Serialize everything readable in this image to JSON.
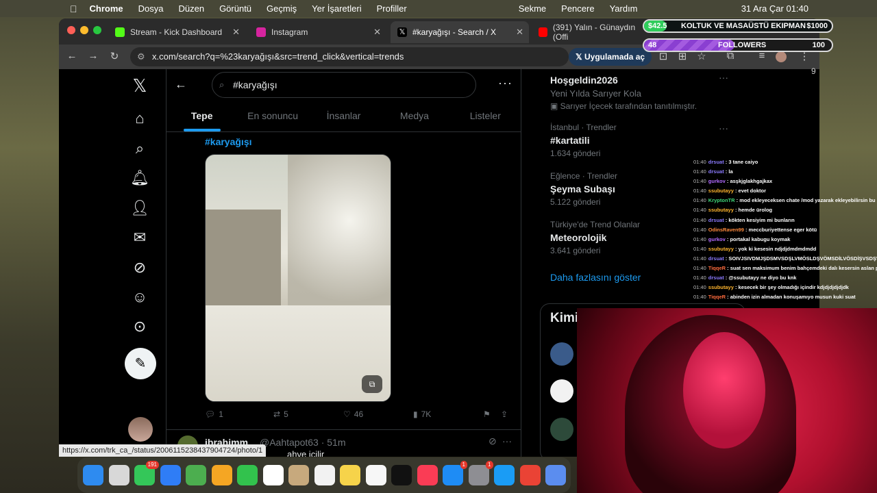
{
  "menubar": {
    "app": "Chrome",
    "items": [
      "Dosya",
      "Düzen",
      "Görüntü",
      "Geçmiş",
      "Yer İşaretleri",
      "Profiller"
    ],
    "right_items": [
      "Sekme",
      "Pencere",
      "Yardım"
    ],
    "clock": "31 Ara Çar  01:40"
  },
  "tabs": [
    {
      "title": "Stream - Kick Dashboard",
      "color": "#53fc18"
    },
    {
      "title": "Instagram",
      "color": "#d6249f"
    },
    {
      "title": "#karyağışı - Search / X",
      "color": "#ffffff"
    },
    {
      "title": "(391) Yalın - Günaydın (Offi",
      "color": "#ff0000"
    }
  ],
  "url": "x.com/search?q=%23karyağışı&src=trend_click&vertical=trends",
  "open_in_app": "Uygulamada aç",
  "search_value": "#karyağışı",
  "x_tabs": [
    "Tepe",
    "En sonuncu",
    "İnsanlar",
    "Medya",
    "Listeler"
  ],
  "tweet": {
    "hashtag": "#karyağışı",
    "replies": "1",
    "reposts": "5",
    "likes": "46",
    "views": "7K"
  },
  "next_tweet": {
    "name": "ibrahimm",
    "handle": "@Aahtapot63 · 51m",
    "snippet": "ahve içilir"
  },
  "status_url": "https://x.com/trk_ca_/status/2006115238437904724/photo/1",
  "trends": [
    {
      "context": "",
      "title": "Hoşgeldin2026",
      "subtitle": "Yeni Yılda Sarıyer Kola",
      "count": "Sarıyer İçecek tarafından tanıtılmıştır."
    },
    {
      "context": "İstanbul · Trendler",
      "title": "#kartatili",
      "subtitle": "",
      "count": "1.634 gönderi"
    },
    {
      "context": "Eğlence · Trendler",
      "title": "Şeyma Subaşı",
      "subtitle": "",
      "count": "5.122 gönderi"
    },
    {
      "context": "Türkiye'de Trend Olanlar",
      "title": "Meteorolojik",
      "subtitle": "",
      "count": "3.641 gönderi"
    }
  ],
  "show_more": "Daha fazlasını göster",
  "who_to_follow": "Kimi",
  "overlay": {
    "goal_current": "$42.5",
    "goal_title": "KOLTUK VE MASAÜSTÜ EKIPMAN",
    "goal_target": "$1000",
    "goal_fraction": 0.0425,
    "followers_current": "48",
    "followers_title": "FOLLOWERS",
    "followers_target": "100",
    "followers_fraction": 0.48
  },
  "chat": [
    {
      "user": "drsuat",
      "color": "#8c7bff",
      "msg": "3 tane caiyo"
    },
    {
      "user": "drsuat",
      "color": "#8c7bff",
      "msg": "la"
    },
    {
      "user": "gurkov",
      "color": "#b26bff",
      "msg": "asşkjglakhgajkax"
    },
    {
      "user": "ssubutayy",
      "color": "#ffb52e",
      "msg": "evet doktor"
    },
    {
      "user": "KryptonTR",
      "color": "#3fd97a",
      "msg": "mod ekleyeceksen chate /mod yazarak ekleyebilirsin bu arada"
    },
    {
      "user": "ssubutayy",
      "color": "#ffb52e",
      "msg": "hemde ürolog"
    },
    {
      "user": "drsuat",
      "color": "#8c7bff",
      "msg": "kökten kesiyim mi bunların"
    },
    {
      "user": "OdinsRaven99",
      "color": "#ff8a3d",
      "msg": "meccburiyettense eger kötü"
    },
    {
      "user": "gurkov",
      "color": "#b26bff",
      "msg": "portakal kabugu koymak"
    },
    {
      "user": "ssubutayy",
      "color": "#ffb52e",
      "msg": "yok ki kesesin ndjdjdmdmdmdd"
    },
    {
      "user": "drsuat",
      "color": "#8c7bff",
      "msg": "SOIVJSIVDMJŞDSMVSDŞLVMÖSLDŞVÖMSDİLVÖSDİŞVSDŞVSÖDS"
    },
    {
      "user": "TiqqeR",
      "color": "#ff6b3d",
      "msg": "suat sen maksimum benim bahçemdeki dalı kesersin aslan parçası"
    },
    {
      "user": "drsuat",
      "color": "#8c7bff",
      "msg": "@ssubutayy ne diyo bu knk"
    },
    {
      "user": "ssubutayy",
      "color": "#ffb52e",
      "msg": "kesecek bir şey olmadığı içindir kdjdjdjdjdjdk"
    },
    {
      "user": "TiqqeR",
      "color": "#ff6b3d",
      "msg": "abinden izin almadan konuşamıyo musun kuki suat"
    }
  ],
  "chat_time": "01:40",
  "sidebar_counter": "9",
  "dock": [
    {
      "name": "finder",
      "color": "#2e8bf0",
      "badge": ""
    },
    {
      "name": "launchpad",
      "color": "#d8d8d8",
      "badge": ""
    },
    {
      "name": "messages",
      "color": "#34c759",
      "badge": "191"
    },
    {
      "name": "mail",
      "color": "#2f7df6",
      "badge": ""
    },
    {
      "name": "maps",
      "color": "#4cae4f",
      "badge": ""
    },
    {
      "name": "photos",
      "color": "#f5a623",
      "badge": ""
    },
    {
      "name": "facetime",
      "color": "#32c24d",
      "badge": ""
    },
    {
      "name": "calendar",
      "color": "#ffffff",
      "badge": ""
    },
    {
      "name": "contacts",
      "color": "#c7a97d",
      "badge": ""
    },
    {
      "name": "reminders",
      "color": "#f2f2f2",
      "badge": ""
    },
    {
      "name": "notes",
      "color": "#f6d34a",
      "badge": ""
    },
    {
      "name": "freeform",
      "color": "#f7f7f7",
      "badge": ""
    },
    {
      "name": "tv",
      "color": "#111111",
      "badge": ""
    },
    {
      "name": "music",
      "color": "#fa3c55",
      "badge": ""
    },
    {
      "name": "app-store",
      "color": "#1e8cf5",
      "badge": "1"
    },
    {
      "name": "system-settings",
      "color": "#8e8e93",
      "badge": "1"
    },
    {
      "name": "safari",
      "color": "#1a9cf5",
      "badge": ""
    },
    {
      "name": "chrome",
      "color": "#ea4335",
      "badge": ""
    },
    {
      "name": "preview",
      "color": "#5b8def",
      "badge": ""
    }
  ]
}
